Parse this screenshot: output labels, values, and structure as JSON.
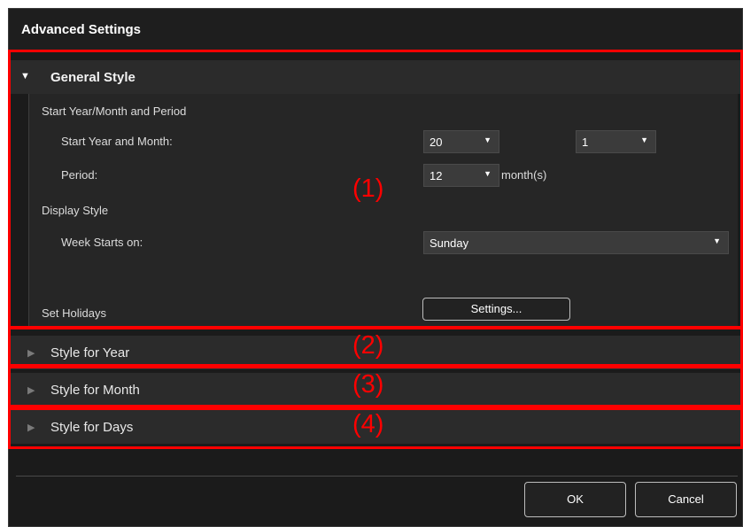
{
  "dialog": {
    "title": "Advanced Settings"
  },
  "general_style": {
    "header": "General Style",
    "group_period": "Start Year/Month and Period",
    "start_label": "Start Year and Month:",
    "start_year": "20",
    "start_month": "1",
    "period_label": "Period:",
    "period_value": "12",
    "period_unit": "month(s)",
    "group_display": "Display Style",
    "week_label": "Week Starts on:",
    "week_value": "Sunday",
    "holidays_label": "Set Holidays",
    "settings_button": "Settings..."
  },
  "sections": [
    {
      "label": "Style for Year"
    },
    {
      "label": "Style for Month"
    },
    {
      "label": "Style for Days"
    }
  ],
  "callouts": [
    "(1)",
    "(2)",
    "(3)",
    "(4)"
  ],
  "footer": {
    "ok": "OK",
    "cancel": "Cancel"
  },
  "colors": {
    "callout": "#ff0000",
    "background": "#1b1b1b",
    "panel": "#262626",
    "header": "#2b2b2b"
  },
  "icons": {
    "expanded": "triangle-down-icon",
    "collapsed": "triangle-right-icon",
    "dropdown": "dropdown-arrow-icon"
  }
}
